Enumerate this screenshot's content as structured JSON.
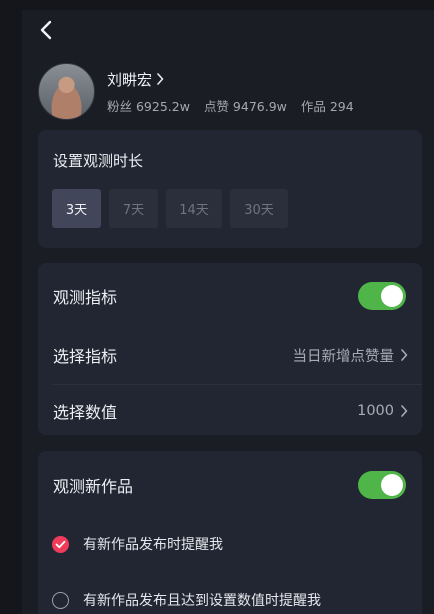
{
  "profile": {
    "name": "刘畊宏",
    "fans": "粉丝 6925.2w",
    "likes": "点赞 9476.9w",
    "works": "作品 294"
  },
  "duration": {
    "title": "设置观测时长",
    "options": [
      "3天",
      "7天",
      "14天",
      "30天"
    ],
    "selected": "3天"
  },
  "metrics": {
    "toggle_label": "观测指标",
    "toggle_on": true,
    "select_metric_label": "选择指标",
    "select_metric_value": "当日新增点赞量",
    "select_value_label": "选择数值",
    "select_value_value": "1000"
  },
  "new_works": {
    "toggle_label": "观测新作品",
    "toggle_on": true,
    "option1": "有新作品发布时提醒我",
    "option1_checked": true,
    "option2": "有新作品发布且达到设置数值时提醒我",
    "option2_checked": false
  },
  "colors": {
    "toggle_on": "#4fb548",
    "radio_checked": "#ee3c5a",
    "background": "#1b1d25",
    "card": "#222532"
  }
}
